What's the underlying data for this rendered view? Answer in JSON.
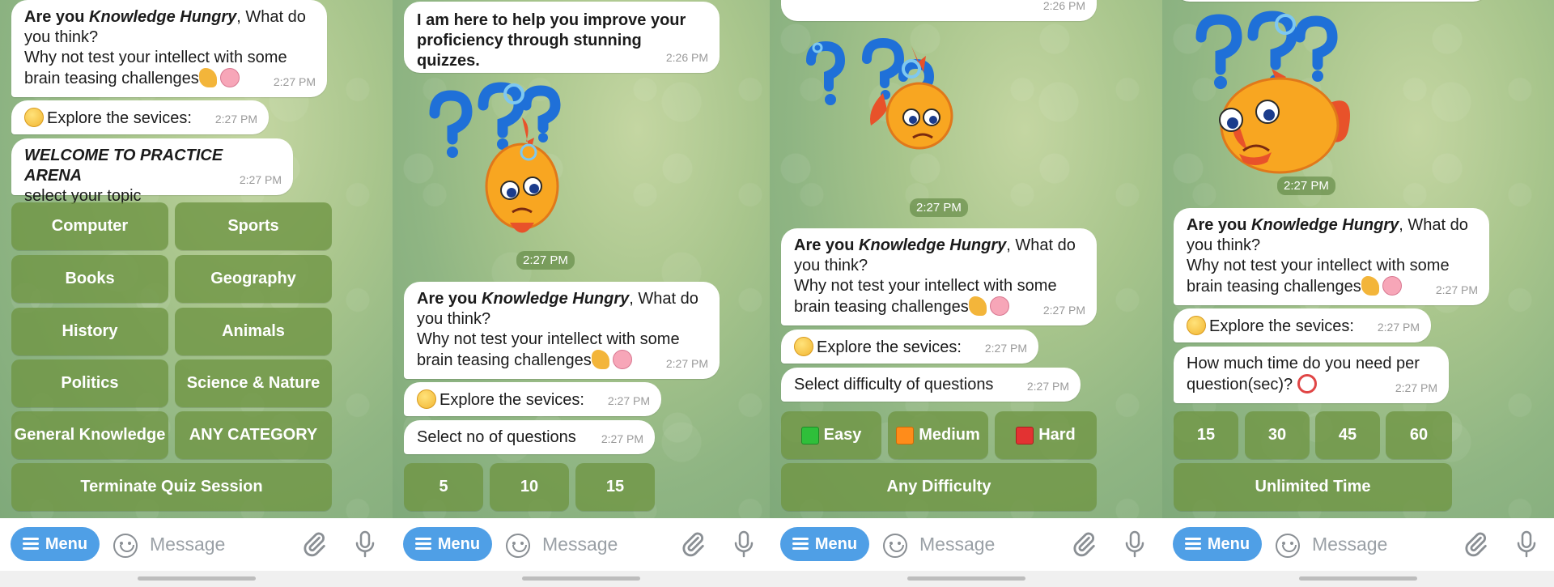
{
  "colors": {
    "accent": "#4f9fe6",
    "keyboard_button": "#7a9a50",
    "chat_background": "#a8c58c",
    "bubble": "#ffffff"
  },
  "bot_prompt": {
    "line1_pre": "Are you ",
    "line1_em": "Knowledge Hungry",
    "line1_post": ", What do",
    "line2": "you think?",
    "line3": "Why not test your intellect with some",
    "line4": "brain teasing challenges"
  },
  "explore": "Explore the sevices:",
  "intro": {
    "line1": "I am here to help you improve your",
    "line2": "proficiency through stunning quizzes."
  },
  "icons": {
    "think": "thinking-face-icon",
    "muscle": "flexed-biceps-icon",
    "brain": "brain-icon",
    "clock": "alarm-clock-icon",
    "sticker": "confused-fish-sticker"
  },
  "input": {
    "menu_label": "Menu",
    "placeholder": "Message"
  },
  "panels": [
    {
      "times": {
        "prompt": "2:27 PM",
        "explore": "2:27 PM",
        "welcome": "2:27 PM"
      },
      "welcome_line1": "WELCOME TO PRACTICE ARENA",
      "welcome_line2": "select your topic",
      "buttons": [
        "Computer",
        "Sports",
        "Books",
        "Geography",
        "History",
        "Animals",
        "Politics",
        "Science & Nature",
        "General Knowledge",
        "ANY CATEGORY"
      ],
      "wide_button": "Terminate Quiz Session"
    },
    {
      "times": {
        "intro": "2:26 PM",
        "sticker": "2:27 PM",
        "prompt": "2:27 PM",
        "explore": "2:27 PM",
        "question": "2:27 PM"
      },
      "question": "Select no of questions",
      "buttons": [
        "5",
        "10",
        "15"
      ]
    },
    {
      "times": {
        "top": "2:26 PM",
        "sticker": "2:27 PM",
        "prompt": "2:27 PM",
        "explore": "2:27 PM",
        "question": "2:27 PM"
      },
      "question": "Select difficulty of questions",
      "buttons": [
        {
          "label": "Easy",
          "icon": "green-square-icon"
        },
        {
          "label": "Medium",
          "icon": "orange-square-icon"
        },
        {
          "label": "Hard",
          "icon": "red-square-icon"
        }
      ],
      "wide_button": "Any Difficulty"
    },
    {
      "times": {
        "sticker": "2:27 PM",
        "prompt": "2:27 PM",
        "explore": "2:27 PM",
        "question": "2:27 PM"
      },
      "question_line1": "How much time do you need per",
      "question_line2": "question(sec)?",
      "buttons": [
        "15",
        "30",
        "45",
        "60"
      ],
      "wide_button": "Unlimited Time"
    }
  ]
}
